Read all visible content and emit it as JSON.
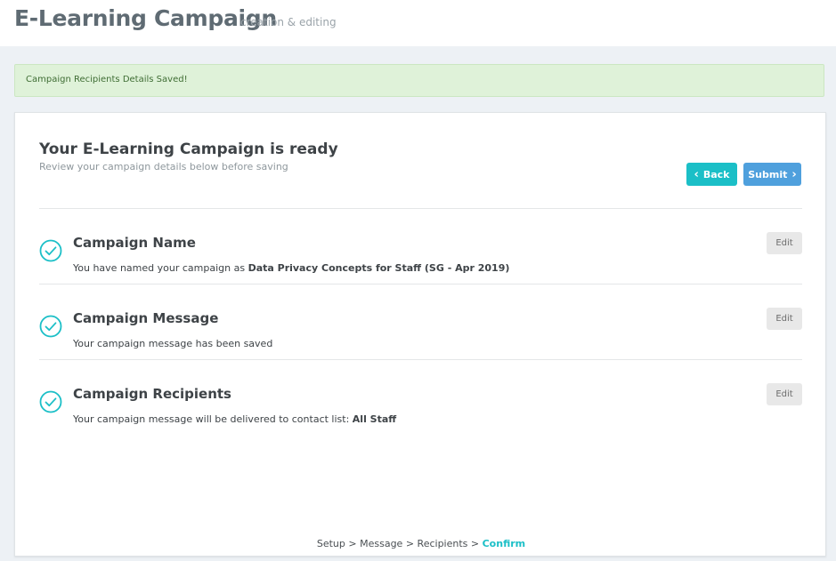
{
  "header": {
    "title": "E-Learning Campaign",
    "subtitle": "creation & editing"
  },
  "alert": {
    "message": "Campaign Recipients Details Saved!"
  },
  "card": {
    "title": "Your E-Learning Campaign is ready",
    "subtitle": "Review your campaign details below before saving",
    "back_label": "Back",
    "submit_label": "Submit"
  },
  "sections": [
    {
      "title": "Campaign Name",
      "text_prefix": "You have named your campaign as ",
      "text_bold": "Data Privacy Concepts for Staff (SG - Apr 2019)",
      "edit_label": "Edit"
    },
    {
      "title": "Campaign Message",
      "text_prefix": "Your campaign message has been saved",
      "text_bold": "",
      "edit_label": "Edit"
    },
    {
      "title": "Campaign Recipients",
      "text_prefix": "Your campaign message will be delivered to contact list: ",
      "text_bold": "All Staff",
      "edit_label": "Edit"
    }
  ],
  "breadcrumb": {
    "steps": [
      "Setup",
      "Message",
      "Recipients"
    ],
    "separator": ">",
    "current": "Confirm"
  },
  "colors": {
    "accent": "#1bbfc7",
    "primary": "#4fa0dd",
    "alert_bg": "#dff2d9",
    "alert_text": "#3f6d34"
  },
  "icons": {
    "back": "chevron-left-icon",
    "submit": "chevron-right-icon",
    "section_status": "check-circle-icon"
  }
}
